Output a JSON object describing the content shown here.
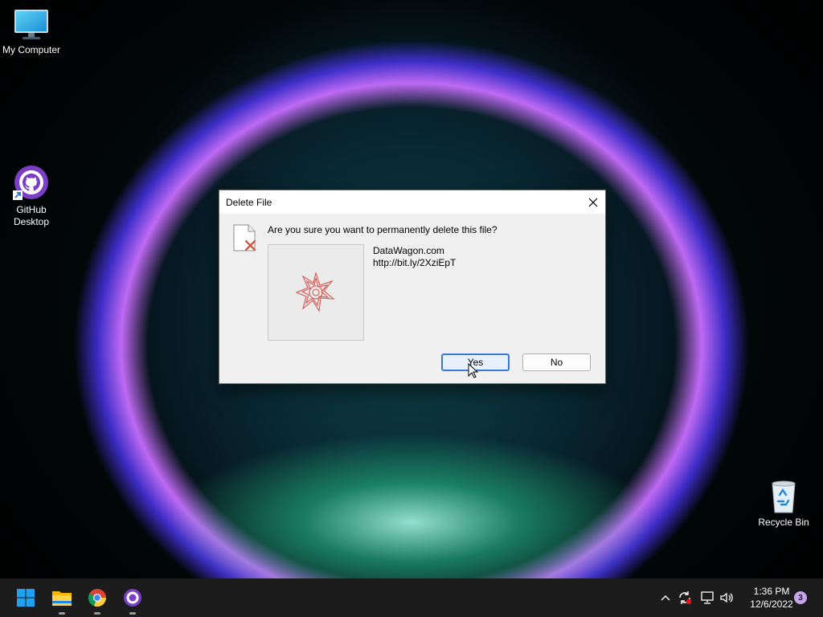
{
  "desktop": {
    "icons": [
      {
        "label": "My Computer",
        "icon": "monitor-icon"
      },
      {
        "label": "GitHub Desktop",
        "icon": "github-desktop-icon"
      },
      {
        "label": "Recycle Bin",
        "icon": "recycle-bin-icon"
      }
    ]
  },
  "dialog": {
    "title": "Delete File",
    "question": "Are you sure you want to permanently delete this file?",
    "file_name": "DataWagon.com",
    "file_url": "http://bit.ly/2XziEpT",
    "yes_label": "Yes",
    "no_label": "No",
    "close_icon": "close-icon"
  },
  "taskbar": {
    "apps": [
      "start-icon",
      "file-explorer-icon",
      "chrome-icon",
      "github-desktop-icon"
    ],
    "tray": [
      "chevron-up-icon",
      "sync-icon",
      "network-icon",
      "volume-icon"
    ],
    "time": "1:36 PM",
    "date": "12/6/2022",
    "notification_count": "3"
  },
  "colors": {
    "accent": "#3b79d0",
    "github_purple": "#6e40c9"
  }
}
